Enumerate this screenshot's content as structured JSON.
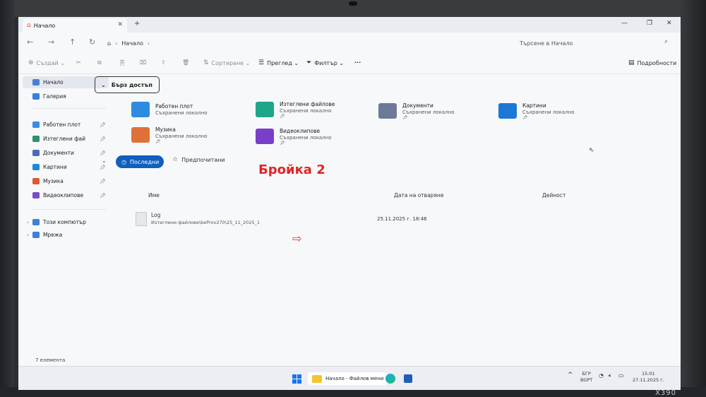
{
  "window": {
    "tab_title": "Начало",
    "tab_close": "✕",
    "new_tab": "+",
    "minimize": "—",
    "maximize": "❐",
    "close": "✕"
  },
  "address": {
    "crumb": "Начало",
    "search_placeholder": "Търсене в Начало"
  },
  "toolbar": {
    "create": "Създай",
    "sort": "Сортиране",
    "view": "Преглед",
    "filter": "Филтър",
    "more": "···",
    "details": "Подробности"
  },
  "sidebar": {
    "items": [
      {
        "label": "Начало",
        "pinned": false
      },
      {
        "label": "Галерия",
        "pinned": false
      },
      {
        "label": "Работен плот",
        "pinned": true
      },
      {
        "label": "Изтеглени файлове",
        "pinned": true
      },
      {
        "label": "Документи",
        "pinned": true
      },
      {
        "label": "Картини",
        "pinned": true
      },
      {
        "label": "Музика",
        "pinned": true
      },
      {
        "label": "Видеоклипове",
        "pinned": true
      },
      {
        "label": "Този компютър",
        "pinned": false
      },
      {
        "label": "Мрежа",
        "pinned": false
      }
    ],
    "colors": [
      "#4a7fd6",
      "#3b7be0",
      "#3a8be6",
      "#2f8f6a",
      "#4b6cb7",
      "#1e88d8",
      "#e2572f",
      "#7b4cc8",
      "#3f7fd8",
      "#3f7fd8"
    ]
  },
  "quick_access": {
    "header": "Бърз достъп",
    "tiles": [
      {
        "name": "Работен плот",
        "sub": "Съхранени локално",
        "color": "#2d8be0"
      },
      {
        "name": "Изтеглени файлове",
        "sub": "Съхранени локално",
        "color": "#1fa58a"
      },
      {
        "name": "Документи",
        "sub": "Съхранени локално",
        "color": "#6b7a96"
      },
      {
        "name": "Картини",
        "sub": "Съхранени локално",
        "color": "#1b78d6"
      },
      {
        "name": "Музика",
        "sub": "Съхранени локално",
        "color": "#e0703a"
      },
      {
        "name": "Видеоклипове",
        "sub": "Съхранени локално",
        "color": "#7a3fc8"
      }
    ]
  },
  "recent": {
    "tab_recent": "Последни",
    "tab_favorites": "Предпочитани",
    "annotation": "Бройка 2",
    "col_name": "Име",
    "col_date": "Дата на отваряне",
    "col_activity": "Дейност",
    "files": [
      {
        "name": "Log",
        "path": "Изтеглени файлове\\beProv270\\25_11_2025_1",
        "date": "25.11.2025 г. 18:46"
      }
    ]
  },
  "status": {
    "count": "7 елемента"
  },
  "taskbar": {
    "explorer_label": "Начало - Файлов мени",
    "lang_top": "БГР",
    "lang_bottom": "BGPT",
    "time": "15:01",
    "date": "27.11.2025 г."
  },
  "device": {
    "model": "X390"
  },
  "accent": "#0f5fbe"
}
